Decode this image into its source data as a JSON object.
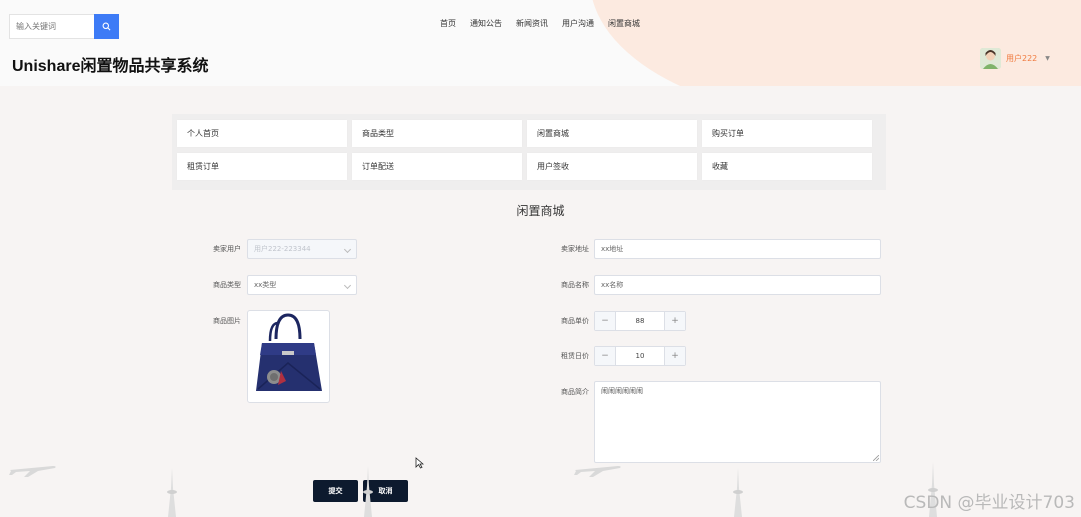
{
  "header": {
    "search_placeholder": "输入关键词",
    "nav": [
      "首页",
      "通知公告",
      "新闻资讯",
      "用户沟通",
      "闲置商城"
    ],
    "site_title": "Unishare闲置物品共享系统",
    "user_name": "用户222"
  },
  "menu": {
    "items": [
      "个人首页",
      "商品类型",
      "闲置商城",
      "购买订单",
      "租赁订单",
      "订单配送",
      "用户签收",
      "收藏"
    ]
  },
  "form": {
    "title": "闲置商城",
    "seller_user_label": "卖家用户",
    "seller_user_value": "用户222-223344",
    "seller_address_label": "卖家地址",
    "seller_address_value": "xx地址",
    "product_type_label": "商品类型",
    "product_type_value": "xx类型",
    "product_name_label": "商品名称",
    "product_name_value": "xx名称",
    "product_image_label": "商品图片",
    "unit_price_label": "商品单价",
    "unit_price_value": "88",
    "rent_price_label": "租赁日价",
    "rent_price_value": "10",
    "intro_label": "商品简介",
    "intro_value": "闹闹闹闹闹闹",
    "submit_label": "提交",
    "cancel_label": "取消",
    "stepper_minus": "−",
    "stepper_plus": "+"
  },
  "watermark": "CSDN @毕业设计703",
  "colors": {
    "accent": "#3d7bf6",
    "user_name": "#f07b3f",
    "button_dark": "#0d1a2e",
    "header_blob": "#fbe6da"
  }
}
